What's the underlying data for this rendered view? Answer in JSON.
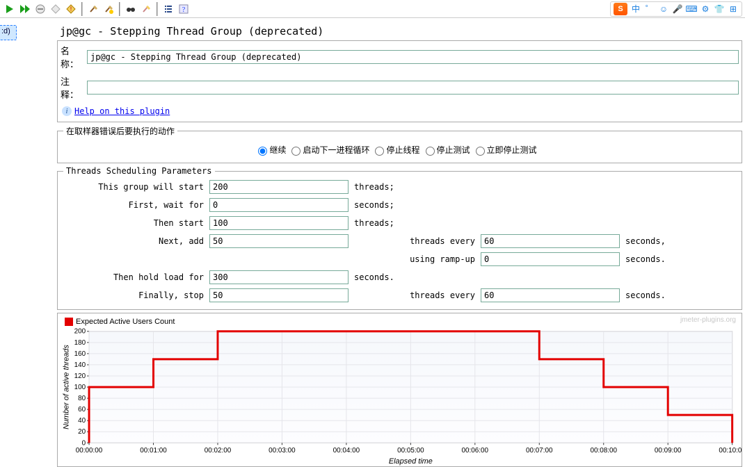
{
  "toolbar": {
    "icons": [
      "play-icon",
      "play-all-icon",
      "stop-icon",
      "stop-all-icon",
      "shutdown-icon",
      "broom-icon",
      "broom-warn-icon",
      "binoculars-icon",
      "broom-color-icon",
      "list-icon",
      "help-icon"
    ],
    "ime": {
      "logo_text": "S",
      "items": [
        "中",
        "゜",
        "☺",
        "🎤",
        "⌨",
        "⚙",
        "👕",
        "⊞"
      ]
    }
  },
  "left_fragment": ":d)",
  "title": "jp@gc - Stepping Thread Group (deprecated)",
  "header": {
    "name_label": "名称：",
    "name_value": "jp@gc - Stepping Thread Group (deprecated)",
    "comment_label": "注释：",
    "comment_value": ""
  },
  "help": {
    "text": "Help on this plugin"
  },
  "error_action": {
    "legend": "在取样器错误后要执行的动作",
    "options": [
      {
        "label": "继续",
        "checked": true
      },
      {
        "label": "启动下一进程循环",
        "checked": false
      },
      {
        "label": "停止线程",
        "checked": false
      },
      {
        "label": "停止测试",
        "checked": false
      },
      {
        "label": "立即停止测试",
        "checked": false
      }
    ]
  },
  "params": {
    "legend": "Threads Scheduling Parameters",
    "start_label": "This group will start",
    "start_value": "200",
    "threads_unit": "threads;",
    "wait_label": "First, wait for",
    "wait_value": "0",
    "seconds_unit": "seconds;",
    "then_start_label": "Then start",
    "then_start_value": "100",
    "next_add_label": "Next, add",
    "next_add_value": "50",
    "threads_every_label": "threads every",
    "threads_every_value": "60",
    "seconds_comma": "seconds,",
    "ramp_label": "using ramp-up",
    "ramp_value": "0",
    "seconds_period": "seconds.",
    "hold_label": "Then hold load for",
    "hold_value": "300",
    "stop_label": "Finally, stop",
    "stop_value": "50",
    "stop_every_value": "60"
  },
  "chart": {
    "legend_label": "Expected Active Users Count",
    "ylabel": "Number of active threads",
    "xlabel": "Elapsed time",
    "watermark": "jmeter-plugins.org"
  },
  "colors": {
    "line": "#e30000",
    "link": "#0000ee"
  },
  "chart_data": {
    "type": "line",
    "title": "",
    "xlabel": "Elapsed time",
    "ylabel": "Number of active threads",
    "ylim": [
      0,
      200
    ],
    "x_ticks": [
      "00:00:00",
      "00:01:00",
      "00:02:00",
      "00:03:00",
      "00:04:00",
      "00:05:00",
      "00:06:00",
      "00:07:00",
      "00:08:00",
      "00:09:00",
      "00:10:00"
    ],
    "y_ticks": [
      0,
      20,
      40,
      60,
      80,
      100,
      120,
      140,
      160,
      180,
      200
    ],
    "series": [
      {
        "name": "Expected Active Users Count",
        "x_seconds": [
          0,
          0,
          60,
          60,
          120,
          120,
          420,
          420,
          480,
          480,
          540,
          540,
          600,
          600
        ],
        "y": [
          0,
          100,
          100,
          150,
          150,
          200,
          200,
          150,
          150,
          100,
          100,
          50,
          50,
          0
        ]
      }
    ],
    "legend_position": "top-left",
    "grid": true
  }
}
